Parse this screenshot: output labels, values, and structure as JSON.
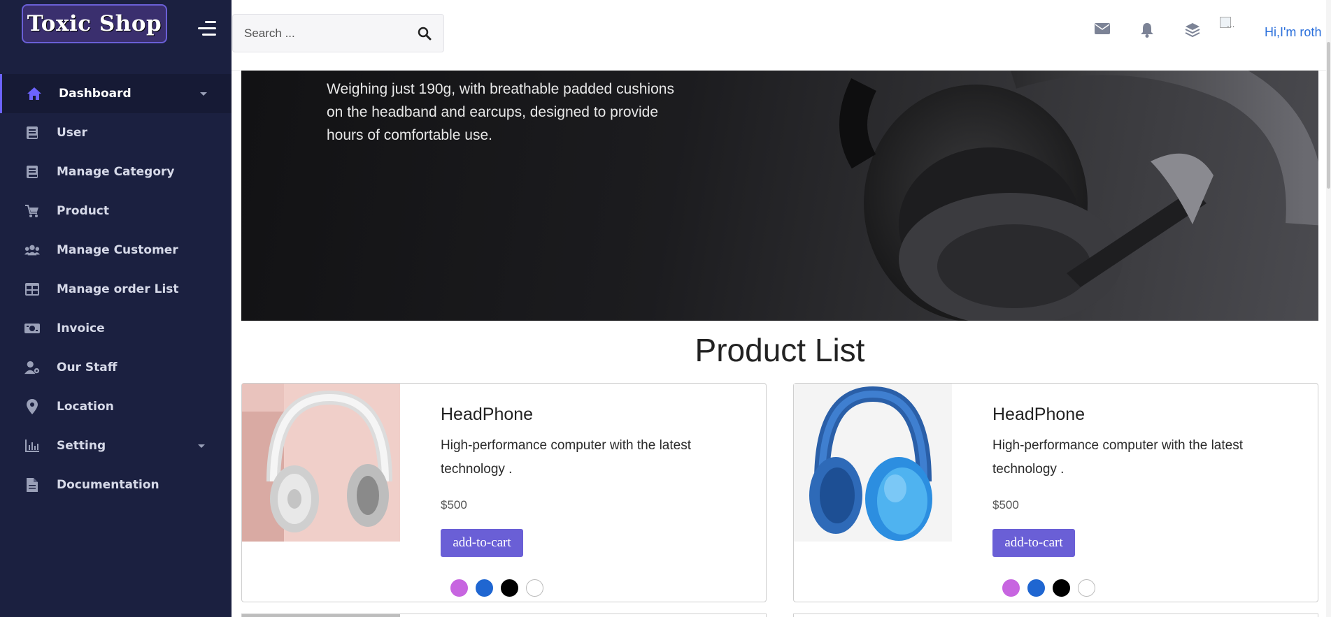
{
  "sidebar": {
    "logo": "Toxic Shop",
    "items": [
      {
        "label": "Dashboard",
        "icon": "home-icon",
        "active": true,
        "has_caret": true
      },
      {
        "label": "User",
        "icon": "book-icon"
      },
      {
        "label": "Manage Category",
        "icon": "book-icon"
      },
      {
        "label": "Product",
        "icon": "cart-icon"
      },
      {
        "label": "Manage Customer",
        "icon": "users-icon"
      },
      {
        "label": "Manage order List",
        "icon": "table-icon"
      },
      {
        "label": "Invoice",
        "icon": "money-icon"
      },
      {
        "label": "Our Staff",
        "icon": "user-gear-icon"
      },
      {
        "label": "Location",
        "icon": "map-pin-icon"
      },
      {
        "label": "Setting",
        "icon": "bar-chart-icon",
        "has_caret": true
      },
      {
        "label": "Documentation",
        "icon": "file-icon"
      }
    ]
  },
  "header": {
    "search_placeholder": "Search ...",
    "avatar_alt": "...",
    "greeting": "Hi,I'm roth",
    "icons": [
      "envelope-icon",
      "bell-icon",
      "layers-icon"
    ]
  },
  "banner": {
    "text": "Weighing just 190g, with breathable padded cushions on the headband and earcups, designed to provide hours of comfortable use."
  },
  "products": {
    "title": "Product List",
    "items": [
      {
        "name": "HeadPhone",
        "description": "High-performance computer with the latest technology .",
        "price": "$500",
        "button": "add-to-cart",
        "image": "white-headphone"
      },
      {
        "name": "HeadPhone",
        "description": "High-performance computer with the latest technology .",
        "price": "$500",
        "button": "add-to-cart",
        "image": "blue-headphone"
      }
    ],
    "swatch_colors": [
      "#c765e0",
      "#1f66d1",
      "#000000",
      "#ffffff"
    ]
  },
  "colors": {
    "sidebar_bg": "#1b2040",
    "accent": "#6a5fd6",
    "link": "#2a6fdb"
  }
}
